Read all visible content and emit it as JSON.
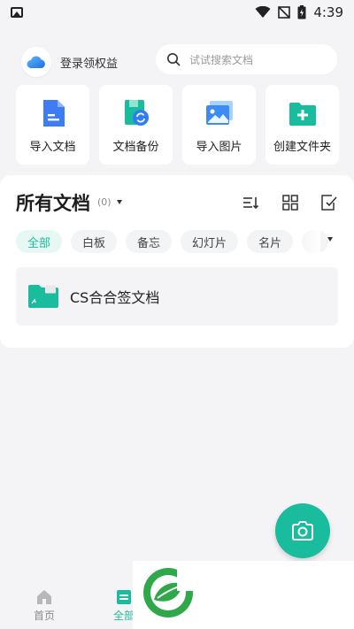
{
  "status_bar": {
    "time": "4:39"
  },
  "header": {
    "login_label": "登录领权益",
    "search_placeholder": "试试搜索文档"
  },
  "actions": [
    {
      "label": "导入文档",
      "icon": "document-import-icon"
    },
    {
      "label": "文档备份",
      "icon": "backup-icon"
    },
    {
      "label": "导入图片",
      "icon": "image-import-icon"
    },
    {
      "label": "创建文件夹",
      "icon": "folder-add-icon"
    }
  ],
  "documents": {
    "title": "所有文档",
    "count": "(0)",
    "filters": [
      "全部",
      "白板",
      "备忘",
      "幻灯片",
      "名片"
    ],
    "active_filter": "全部",
    "items": [
      {
        "name": "CS合合签文档"
      }
    ]
  },
  "bottom_nav": {
    "items": [
      {
        "label": "首页"
      },
      {
        "label": "全部"
      }
    ]
  },
  "colors": {
    "accent": "#19bc9c",
    "background": "#f4f4f6",
    "card": "#ffffff",
    "blue_icon": "#3d7cf4"
  }
}
